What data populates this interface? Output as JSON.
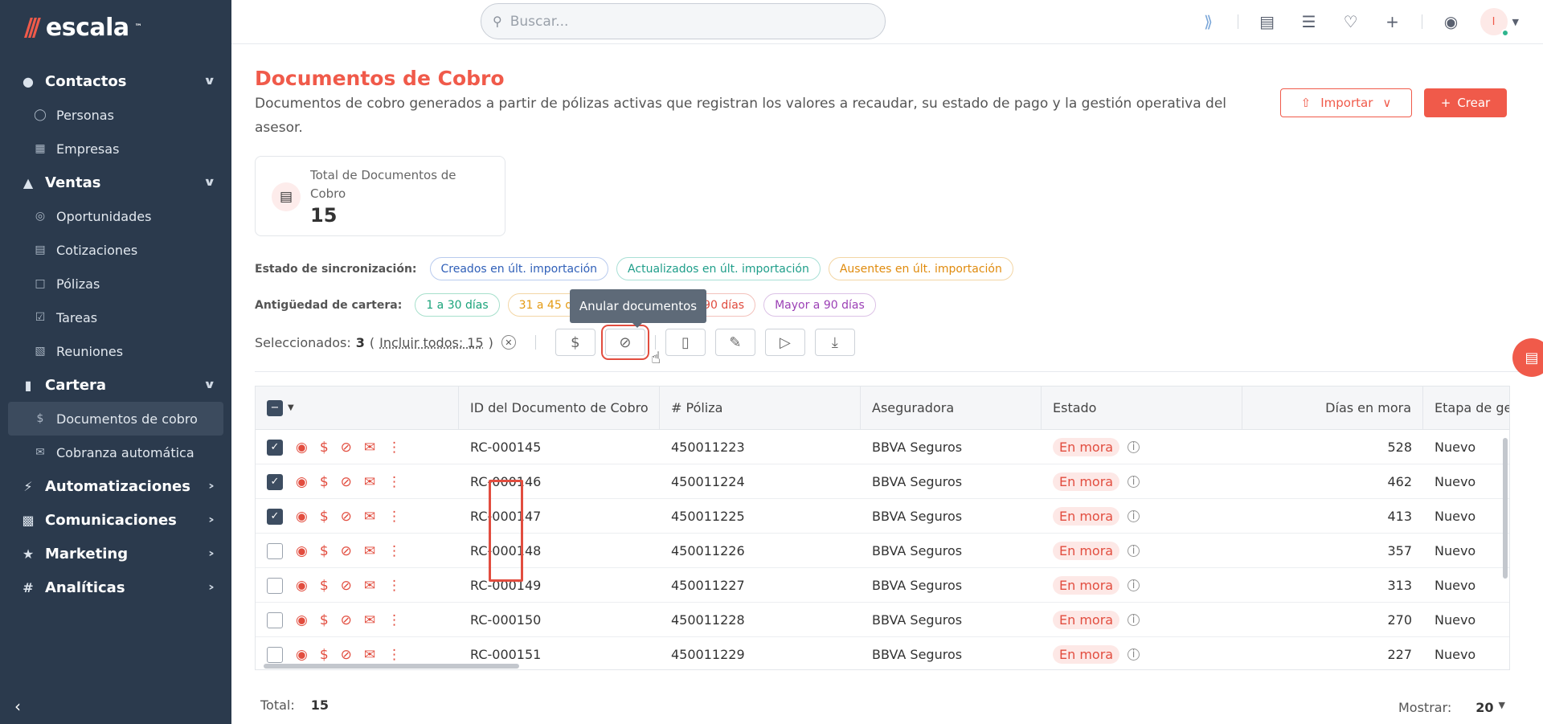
{
  "brand": {
    "name": "escala",
    "tm": "™"
  },
  "search": {
    "placeholder": "Buscar..."
  },
  "sidebar": {
    "sections": [
      {
        "label": "Contactos",
        "items": [
          "Personas",
          "Empresas"
        ]
      },
      {
        "label": "Ventas",
        "items": [
          "Oportunidades",
          "Cotizaciones",
          "Pólizas",
          "Tareas",
          "Reuniones"
        ]
      },
      {
        "label": "Cartera",
        "items": [
          "Documentos de cobro",
          "Cobranza automática"
        ]
      },
      {
        "label": "Automatizaciones",
        "items": []
      },
      {
        "label": "Comunicaciones",
        "items": []
      },
      {
        "label": "Marketing",
        "items": []
      },
      {
        "label": "Analíticas",
        "items": []
      }
    ],
    "active": "Documentos de cobro"
  },
  "user": {
    "initial": "I"
  },
  "page": {
    "title": "Documentos de Cobro",
    "description": "Documentos de cobro generados a partir de pólizas activas que registran los valores a recaudar, su estado de pago y la gestión operativa del asesor.",
    "import_label": "Importar",
    "create_label": "Crear"
  },
  "summary": {
    "label": "Total de Documentos de Cobro",
    "value": "15"
  },
  "sync": {
    "label": "Estado de sincronización:",
    "chips": [
      "Creados en últ. importación",
      "Actualizados en últ. importación",
      "Ausentes en últ. importación"
    ]
  },
  "aging": {
    "label": "Antigüedad de cartera:",
    "chips": [
      "1 a 30 días",
      "31 a 45 días",
      "61 a 90 días",
      "Mayor a 90 días"
    ]
  },
  "selection": {
    "label": "Seleccionados:",
    "count": "3",
    "include_all": "Incluir todos: 15",
    "tooltip": "Anular documentos"
  },
  "colors": {
    "accent": "#f05a4a",
    "sidebar": "#2b3a4d"
  },
  "table": {
    "columns": [
      "ID del Documento de Cobro",
      "# Póliza",
      "Aseguradora",
      "Estado",
      "Días en mora",
      "Etapa de ge"
    ],
    "rows": [
      {
        "id": "RC-000145",
        "poliza": "450011223",
        "aseguradora": "BBVA Seguros",
        "estado": "En mora",
        "dias": "528",
        "etapa": "Nuevo",
        "checked": true
      },
      {
        "id": "RC-000146",
        "poliza": "450011224",
        "aseguradora": "BBVA Seguros",
        "estado": "En mora",
        "dias": "462",
        "etapa": "Nuevo",
        "checked": true
      },
      {
        "id": "RC-000147",
        "poliza": "450011225",
        "aseguradora": "BBVA Seguros",
        "estado": "En mora",
        "dias": "413",
        "etapa": "Nuevo",
        "checked": true
      },
      {
        "id": "RC-000148",
        "poliza": "450011226",
        "aseguradora": "BBVA Seguros",
        "estado": "En mora",
        "dias": "357",
        "etapa": "Nuevo",
        "checked": false
      },
      {
        "id": "RC-000149",
        "poliza": "450011227",
        "aseguradora": "BBVA Seguros",
        "estado": "En mora",
        "dias": "313",
        "etapa": "Nuevo",
        "checked": false
      },
      {
        "id": "RC-000150",
        "poliza": "450011228",
        "aseguradora": "BBVA Seguros",
        "estado": "En mora",
        "dias": "270",
        "etapa": "Nuevo",
        "checked": false
      },
      {
        "id": "RC-000151",
        "poliza": "450011229",
        "aseguradora": "BBVA Seguros",
        "estado": "En mora",
        "dias": "227",
        "etapa": "Nuevo",
        "checked": false
      }
    ]
  },
  "footer": {
    "total_label": "Total:",
    "total_value": "15",
    "show_label": "Mostrar:",
    "show_value": "20"
  }
}
